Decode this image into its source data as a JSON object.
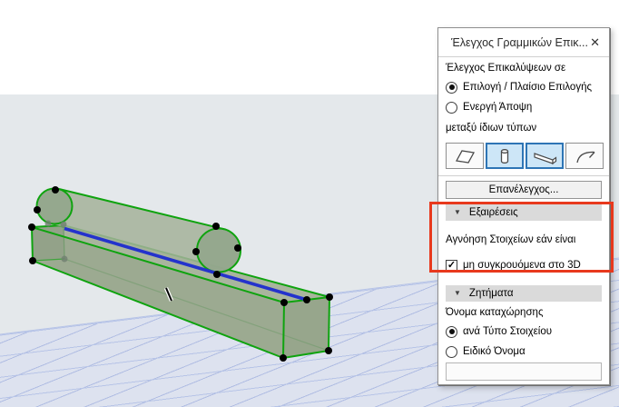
{
  "window": {
    "title": "Έλεγχος Γραμμικών Επικ...",
    "close_glyph": "✕"
  },
  "scope": {
    "label": "Έλεγχος Επικαλύψεων σε",
    "options": [
      {
        "label": "Επιλογή / Πλαίσιο Επιλογής",
        "selected": true
      },
      {
        "label": "Ενεργή Άποψη",
        "selected": false
      }
    ]
  },
  "between_types_label": "μεταξύ ίδιων τύπων",
  "type_filter": {
    "buttons": [
      {
        "icon": "slab-icon",
        "selected": false
      },
      {
        "icon": "column-icon",
        "selected": true
      },
      {
        "icon": "beam-icon",
        "selected": true
      },
      {
        "icon": "curve-icon",
        "selected": false
      }
    ],
    "selected_bg": "#cde6f7",
    "selected_border": "#2e75b5"
  },
  "recheck_label": "Επανέλεγχος...",
  "exceptions": {
    "header": "Εξαιρέσεις",
    "collapse_glyph": "▼",
    "ignore_label": "Αγνόηση Στοιχείων εάν είναι",
    "checkbox": {
      "label": "μη συγκρουόμενα στο 3D",
      "checked": true,
      "check_glyph": "✓"
    }
  },
  "issues": {
    "header": "Ζητήματα",
    "collapse_glyph": "▼",
    "name_label": "Όνομα καταχώρησης",
    "options": [
      {
        "label": "ανά Τύπο Στοιχείου",
        "selected": true
      },
      {
        "label": "Ειδικό Όνομα",
        "selected": false
      }
    ],
    "custom_name_value": ""
  },
  "annotation": {
    "color": "#e8391d"
  },
  "scene": {
    "elements": [
      "column",
      "beam"
    ],
    "selection_color": "#0fa30f",
    "overlap_line_color": "#2433cc",
    "node_color": "#000000",
    "grid_line_color": "#b7c4e7"
  }
}
